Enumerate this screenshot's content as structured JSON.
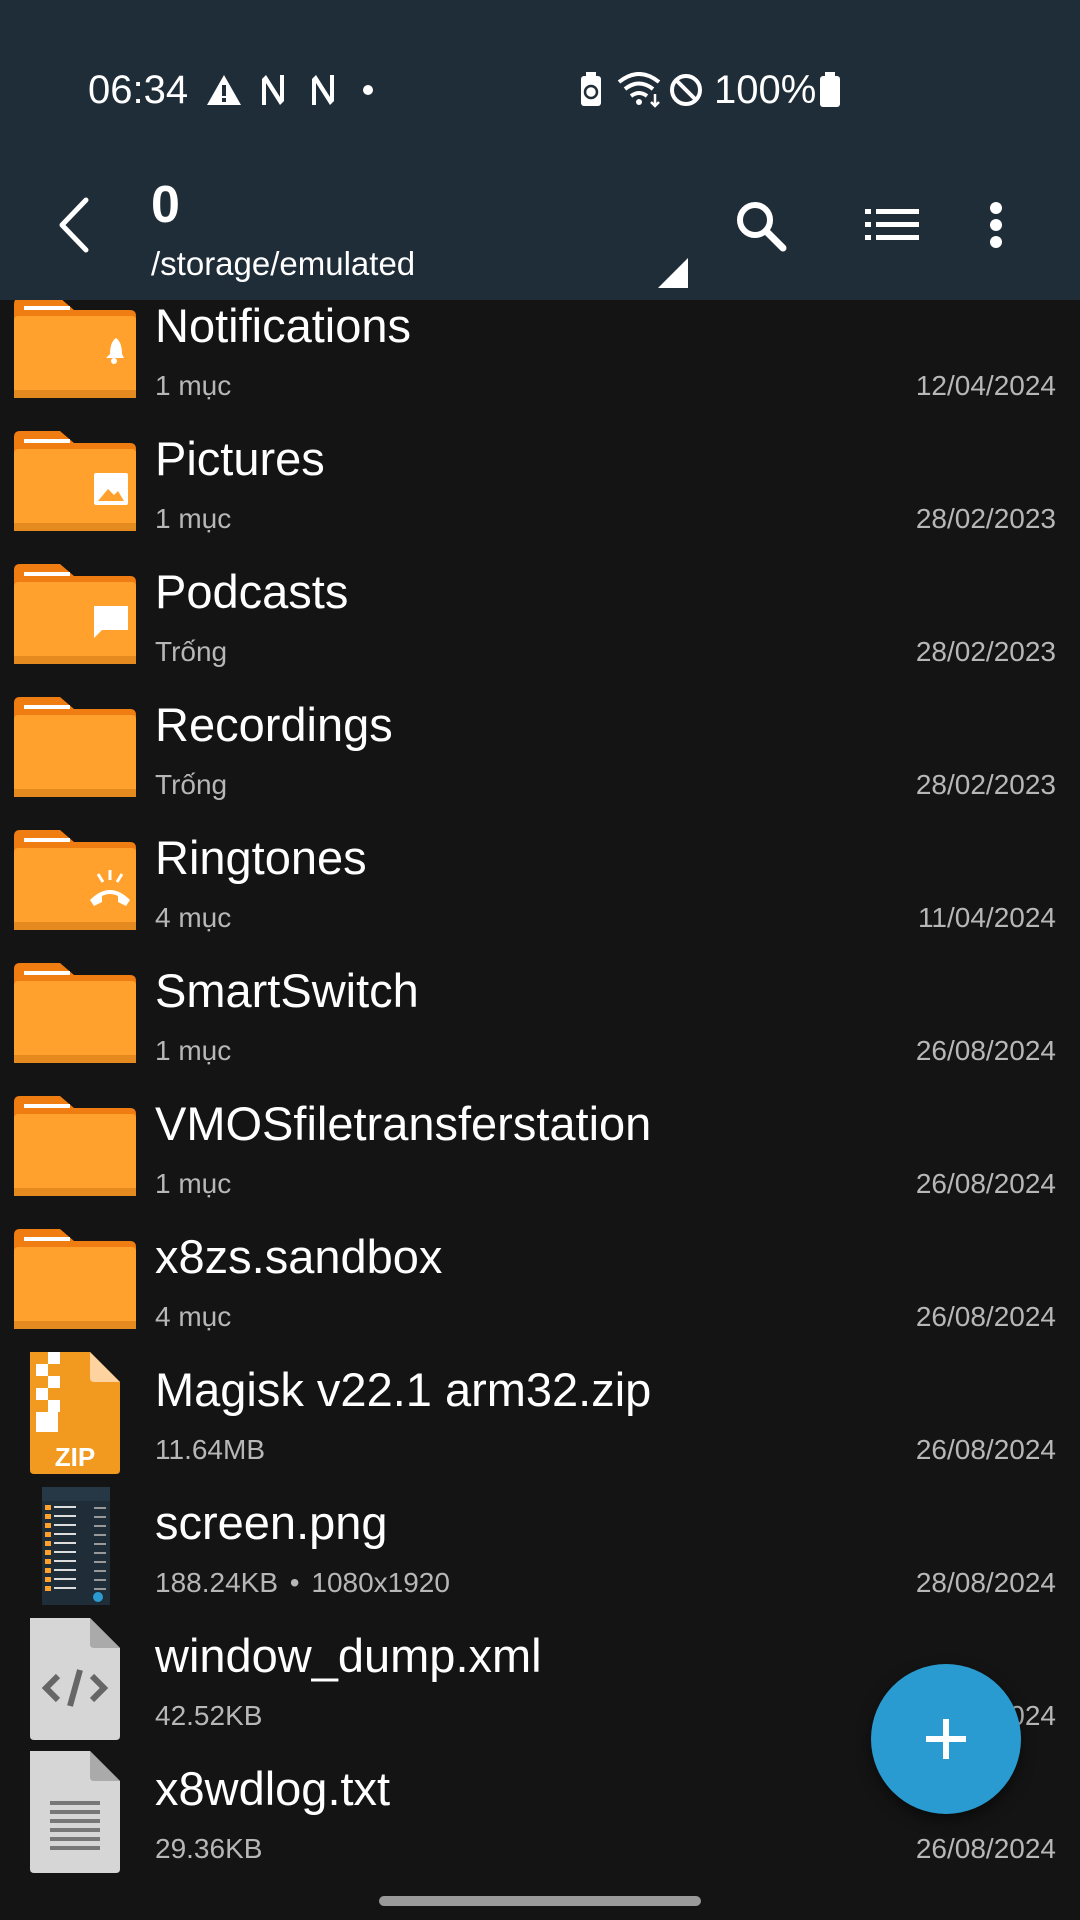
{
  "status_bar": {
    "time": "06:34",
    "battery": "100%",
    "icons": [
      "warning-icon",
      "n-icon",
      "n-icon",
      "dot-icon",
      "battery-saver-icon",
      "wifi-icon",
      "do-not-disturb-icon",
      "battery-icon"
    ]
  },
  "app_bar": {
    "title": "0",
    "path": "/storage/emulated",
    "icons": [
      "back-icon",
      "search-icon",
      "list-view-icon",
      "more-icon"
    ]
  },
  "files": [
    {
      "name": "Notifications",
      "meta": "1 mục",
      "date": "12/04/2024",
      "type": "folder",
      "badge": "bell"
    },
    {
      "name": "Pictures",
      "meta": "1 mục",
      "date": "28/02/2023",
      "type": "folder",
      "badge": "image"
    },
    {
      "name": "Podcasts",
      "meta": "Trống",
      "date": "28/02/2023",
      "type": "folder",
      "badge": "chat"
    },
    {
      "name": "Recordings",
      "meta": "Trống",
      "date": "28/02/2023",
      "type": "folder",
      "badge": ""
    },
    {
      "name": "Ringtones",
      "meta": "4 mục",
      "date": "11/04/2024",
      "type": "folder",
      "badge": "ringtone"
    },
    {
      "name": "SmartSwitch",
      "meta": "1 mục",
      "date": "26/08/2024",
      "type": "folder",
      "badge": ""
    },
    {
      "name": "VMOSfiletransferstation",
      "meta": "1 mục",
      "date": "26/08/2024",
      "type": "folder",
      "badge": ""
    },
    {
      "name": "x8zs.sandbox",
      "meta": "4 mục",
      "date": "26/08/2024",
      "type": "folder",
      "badge": ""
    },
    {
      "name": "Magisk v22.1 arm32.zip",
      "meta": "11.64MB",
      "date": "26/08/2024",
      "type": "zip",
      "zip_label": "ZIP"
    },
    {
      "name": "screen.png",
      "meta": "188.24KB",
      "extra": "1080x1920",
      "date": "28/08/2024",
      "type": "image"
    },
    {
      "name": "window_dump.xml",
      "meta": "42.52KB",
      "date": "",
      "date_partial": "024",
      "type": "xml"
    },
    {
      "name": "x8wdlog.txt",
      "meta": "29.36KB",
      "date": "26/08/2024",
      "type": "txt"
    }
  ],
  "colors": {
    "appbar": "#1f2d38",
    "background": "#141414",
    "folder": "#ffa12c",
    "folder_tab": "#f07d12",
    "fab": "#2a9bd1"
  },
  "fab": {
    "icon": "plus-icon"
  }
}
